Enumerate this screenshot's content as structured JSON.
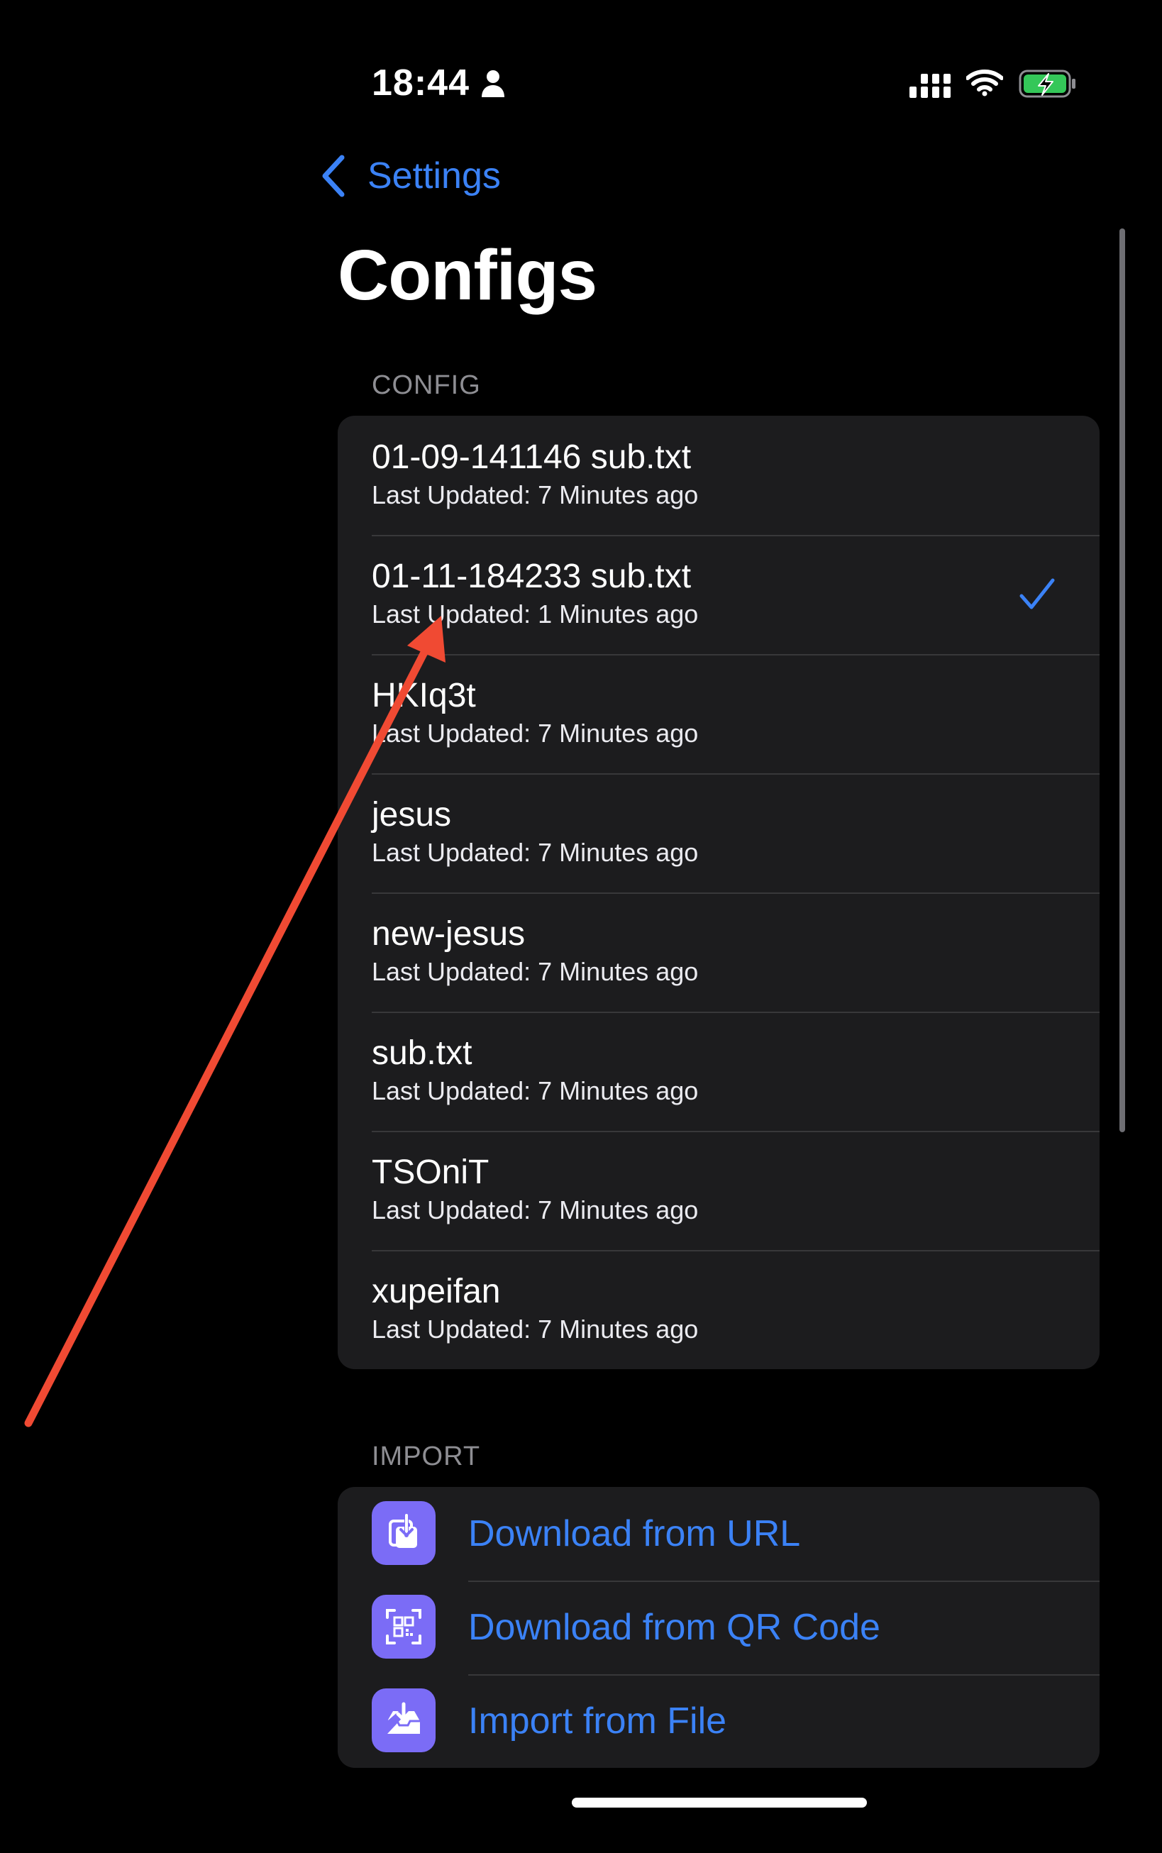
{
  "status_bar": {
    "time": "18:44",
    "icons": [
      "person-icon",
      "signal-icon",
      "wifi-icon",
      "battery-charging-icon"
    ]
  },
  "nav": {
    "back_label": "Settings",
    "title": "Configs"
  },
  "config_section": {
    "header": "CONFIG",
    "selected_index": 1,
    "items": [
      {
        "name": "01-09-141146 sub.txt",
        "updated": "Last Updated: 7 Minutes ago"
      },
      {
        "name": "01-11-184233 sub.txt",
        "updated": "Last Updated: 1 Minutes ago"
      },
      {
        "name": "HKIq3t",
        "updated": "Last Updated: 7 Minutes ago"
      },
      {
        "name": "jesus",
        "updated": "Last Updated: 7 Minutes ago"
      },
      {
        "name": "new-jesus",
        "updated": "Last Updated: 7 Minutes ago"
      },
      {
        "name": "sub.txt",
        "updated": "Last Updated: 7 Minutes ago"
      },
      {
        "name": "TSOniT",
        "updated": "Last Updated: 7 Minutes ago"
      },
      {
        "name": "xupeifan",
        "updated": "Last Updated: 7 Minutes ago"
      }
    ]
  },
  "import_section": {
    "header": "IMPORT",
    "items": [
      {
        "label": "Download from URL",
        "icon": "download-icon"
      },
      {
        "label": "Download from QR Code",
        "icon": "qr-code-icon"
      },
      {
        "label": "Import from File",
        "icon": "tray-import-icon"
      }
    ]
  },
  "colors": {
    "background": "#000000",
    "group_background": "#1c1c1e",
    "accent": "#3b82f6",
    "icon_tile": "#7b6cf6",
    "annotation": "#f04a33",
    "battery_charge": "#34c759"
  }
}
